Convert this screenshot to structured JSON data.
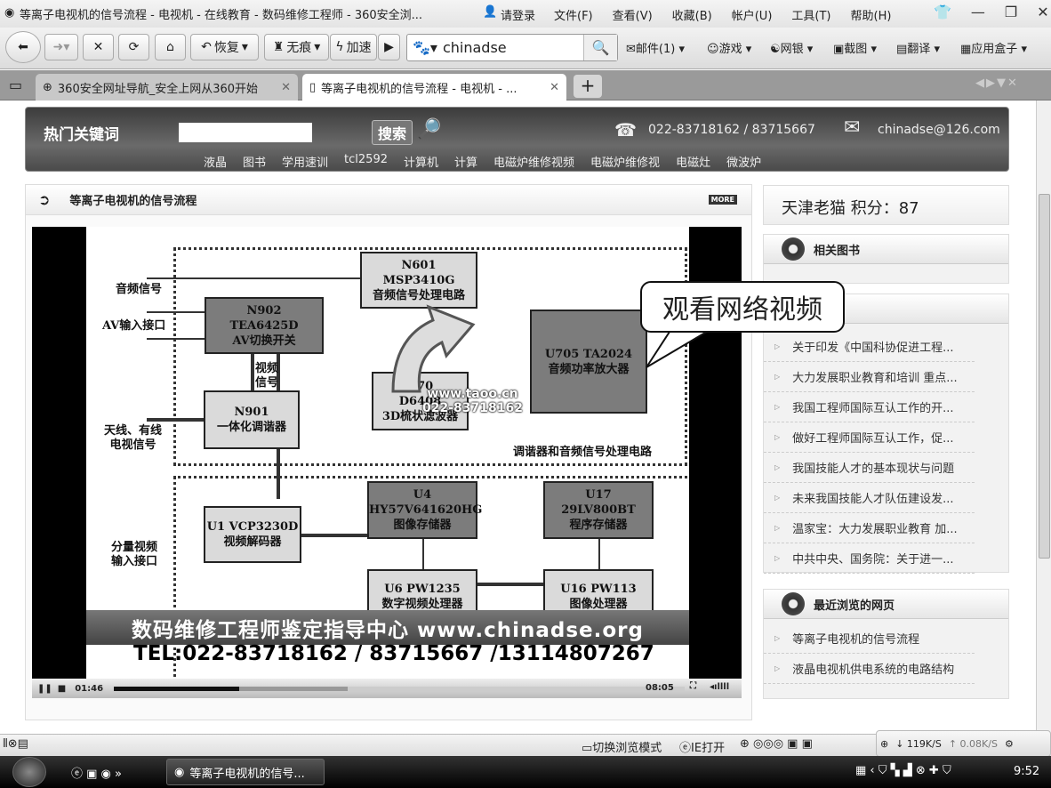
{
  "window": {
    "title": "等离子电视机的信号流程 - 电视机 - 在线教育 - 数码维修工程师 - 360安全浏...",
    "login": "请登录",
    "menu": [
      "文件(F)",
      "查看(V)",
      "收藏(B)",
      "帐户(U)",
      "工具(T)",
      "帮助(H)"
    ]
  },
  "toolbar": {
    "restore": "恢复",
    "incognito": "无痕",
    "speed": "加速",
    "address": "chinadse",
    "extensions": [
      "邮件(1)",
      "游戏",
      "网银",
      "截图",
      "翻译",
      "应用盒子"
    ]
  },
  "tabs": [
    {
      "label": "360安全网址导航_安全上网从360开始"
    },
    {
      "label": "等离子电视机的信号流程 - 电视机 - ..."
    }
  ],
  "header": {
    "keywords_label": "热门关键词",
    "search_button": "搜索",
    "phone": "022-83718162 / 83715667",
    "email": "chinadse@126.com",
    "links": [
      "液晶",
      "图书",
      "学用速训",
      "tcl2592",
      "计算机",
      "计算",
      "电磁炉维修视频",
      "电磁炉维修视",
      "电磁灶",
      "微波炉"
    ]
  },
  "article": {
    "title": "等离子电视机的信号流程",
    "more": "MORE"
  },
  "video": {
    "blocks": {
      "n601": [
        "N601",
        "MSP3410G",
        "音频信号处理电路"
      ],
      "n902": [
        "N902",
        "TEA6425D",
        "AV切换开关"
      ],
      "u705": [
        "U705  TA2024",
        "音频功率放大器"
      ],
      "u70": [
        "U70",
        "D6408",
        "3D梳状滤波器"
      ],
      "n901": [
        "N901",
        "一体化调谐器"
      ],
      "u1": [
        "U1  VCP3230D",
        "视频解码器"
      ],
      "u4": [
        "U4",
        "HY57V641620HG",
        "图像存储器"
      ],
      "u17": [
        "U17",
        "29LV800BT",
        "程序存储器"
      ],
      "u6": [
        "U6  PW1235",
        "数字视频处理器"
      ],
      "u16": [
        "U16  PW113",
        "图像处理器"
      ]
    },
    "labels": {
      "audio": "音频信号",
      "av": "AV输入接口",
      "video_sig": "视频\n信号",
      "antenna": "天线、有线\n电视信号",
      "component": "分量视频\n输入接口",
      "section": "调谐器和音频信号处理电路"
    },
    "watermark": [
      "www.taoo.cn",
      "022-83718162"
    ],
    "banner": "数码维修工程师鉴定指导中心 www.chinadse.org",
    "tel": "TEL:022-83718162 / 83715667 /13114807267",
    "callout": "观看网络视频",
    "elapsed": "01:46",
    "duration": "08:05",
    "progress": 0.22,
    "buffered": 0.41
  },
  "sidebar": {
    "user": "天津老猫 积分：87",
    "books_title": "相关图书",
    "news_title": "资讯",
    "news": [
      "关于印发《中国科协促进工程...",
      "大力发展职业教育和培训 重点...",
      "我国工程师国际互认工作的开...",
      "做好工程师国际互认工作，促...",
      "我国技能人才的基本现状与问题",
      "未来我国技能人才队伍建设发...",
      "温家宝：大力发展职业教育 加...",
      "中共中央、国务院：关于进一..."
    ],
    "recent_title": "最近浏览的网页",
    "recent": [
      "等离子电视机的信号流程",
      "液晶电视机供电系统的电路结构"
    ]
  },
  "status": {
    "switch_mode": "切换浏览模式",
    "ie_open": "IE打开",
    "down": "↓ 119K/S",
    "up": "↑ 0.08K/S"
  },
  "taskbar": {
    "task": "等离子电视机的信号...",
    "time": "9:52"
  }
}
